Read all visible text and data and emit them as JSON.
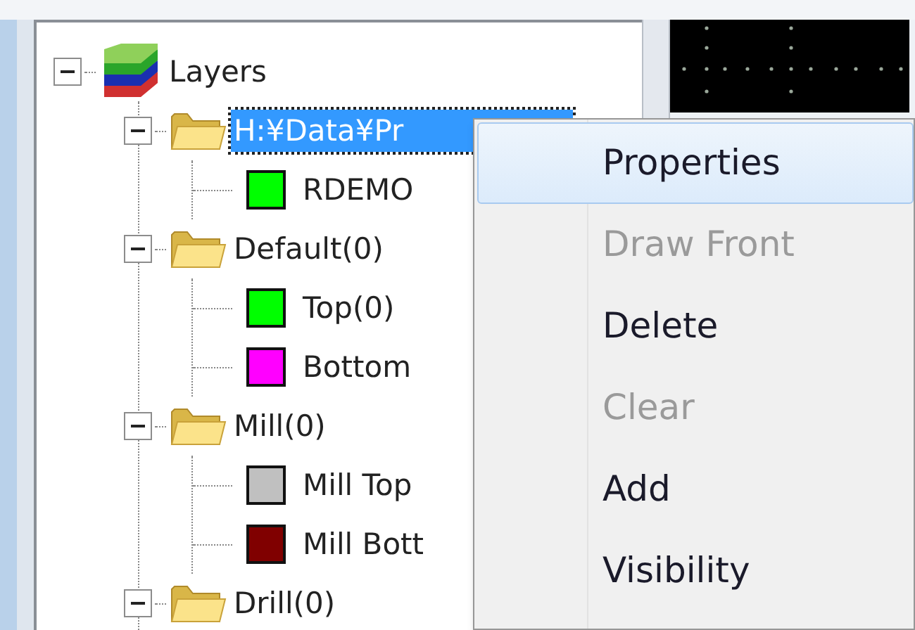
{
  "tree": {
    "label": "Layers",
    "kind": "root",
    "expanded": true,
    "selected": false,
    "children": [
      {
        "label": "H:¥Data¥Pr",
        "kind": "folder",
        "expanded": true,
        "selected": true,
        "children": [
          {
            "label": "RDEMO",
            "kind": "layer",
            "color": "#00ff00",
            "selected": false
          }
        ]
      },
      {
        "label": "Default(0)",
        "kind": "folder",
        "expanded": true,
        "selected": false,
        "children": [
          {
            "label": "Top(0)",
            "kind": "layer",
            "color": "#00ff00",
            "selected": false
          },
          {
            "label": "Bottom",
            "kind": "layer",
            "color": "#ff00ff",
            "selected": false
          }
        ]
      },
      {
        "label": "Mill(0)",
        "kind": "folder",
        "expanded": true,
        "selected": false,
        "children": [
          {
            "label": "Mill Top",
            "kind": "layer",
            "color": "#c0c0c0",
            "selected": false
          },
          {
            "label": "Mill Bott",
            "kind": "layer",
            "color": "#800000",
            "selected": false
          }
        ]
      },
      {
        "label": "Drill(0)",
        "kind": "folder",
        "expanded": true,
        "selected": false
      }
    ]
  },
  "context_menu": [
    {
      "label": "Properties",
      "disabled": false,
      "selected": true
    },
    {
      "label": "Draw Front",
      "disabled": true,
      "selected": false
    },
    {
      "label": "Delete",
      "disabled": false,
      "selected": false
    },
    {
      "label": "Clear",
      "disabled": true,
      "selected": false
    },
    {
      "label": "Add",
      "disabled": false,
      "selected": false
    },
    {
      "label": "Visibility",
      "disabled": false,
      "selected": false
    }
  ]
}
